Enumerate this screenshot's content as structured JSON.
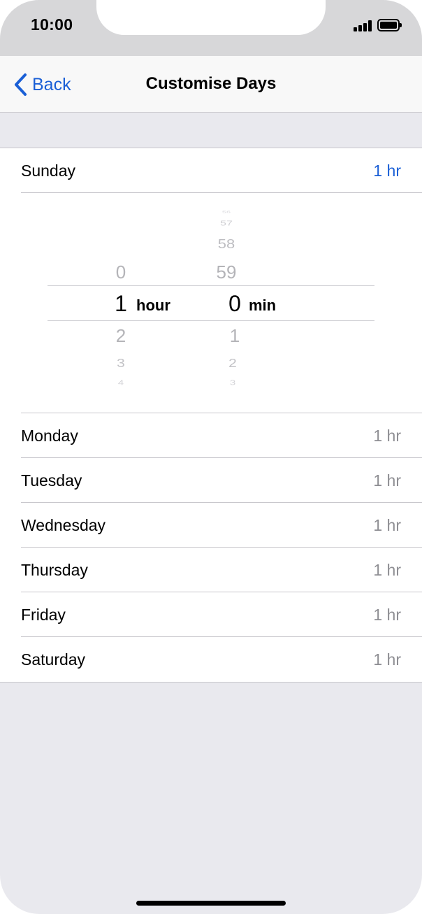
{
  "status_bar": {
    "time": "10:00"
  },
  "nav": {
    "back_label": "Back",
    "title": "Customise Days"
  },
  "sunday": {
    "label": "Sunday",
    "value": "1 hr"
  },
  "picker": {
    "hours_above": [
      "0"
    ],
    "hour_selected": "1",
    "hours_below": [
      "2",
      "3",
      "4"
    ],
    "hour_unit": "hour",
    "minutes_above": [
      "56",
      "57",
      "58",
      "59"
    ],
    "minute_selected": "0",
    "minutes_below": [
      "1",
      "2",
      "3"
    ],
    "minute_unit": "min"
  },
  "days": [
    {
      "label": "Monday",
      "value": "1 hr"
    },
    {
      "label": "Tuesday",
      "value": "1 hr"
    },
    {
      "label": "Wednesday",
      "value": "1 hr"
    },
    {
      "label": "Thursday",
      "value": "1 hr"
    },
    {
      "label": "Friday",
      "value": "1 hr"
    },
    {
      "label": "Saturday",
      "value": "1 hr"
    }
  ],
  "colors": {
    "accent": "#1a5fd6",
    "secondary_text": "#8e8e93",
    "background": "#e9e9ee"
  }
}
